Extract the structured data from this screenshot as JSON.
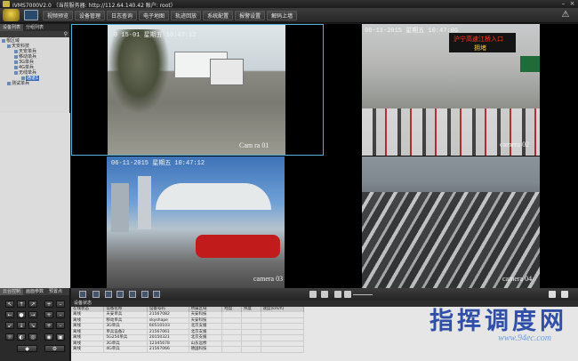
{
  "window": {
    "title": "IVMS7000V2.0 （当前服务器: http://112.64.140.42 账户: root）"
  },
  "toolbar": {
    "tabs": [
      "视频预览",
      "设备管理",
      "日志查询",
      "电子地图",
      "轨迹回放",
      "系统配置",
      "报警设置",
      "解码上墙"
    ]
  },
  "left_panel": {
    "tabs": [
      "设备列表",
      "分组列表"
    ],
    "tree": [
      {
        "label": "根区域",
        "level": 0
      },
      {
        "label": "天安科技",
        "level": 1
      },
      {
        "label": "天安单兵",
        "level": 2
      },
      {
        "label": "移动单兵",
        "level": 2
      },
      {
        "label": "3G单兵",
        "level": 2
      },
      {
        "label": "4G单兵",
        "level": 2
      },
      {
        "label": "无线单兵",
        "level": 2
      },
      {
        "label": "通道1",
        "level": 3,
        "selected": true
      },
      {
        "label": "测试单兵",
        "level": 1
      }
    ]
  },
  "video": {
    "cells": [
      {
        "osd": "0    15-01  星期五  10:47:12",
        "camera": "Cam  ra  01",
        "active": true
      },
      {
        "osd": "06-11-2015  星期五  10:47:06",
        "camera": "camera  02",
        "sign_line1": "沪宁高速江桥入口",
        "sign_line2": "拥堵"
      },
      {
        "osd": "06-11-2015    星期五    10:47:12",
        "camera": "camera  03"
      },
      {
        "osd": "",
        "camera": "camera  04"
      }
    ]
  },
  "ptz": {
    "tabs": [
      "云台控制",
      "画面参数",
      "预置点"
    ]
  },
  "device_table": {
    "title": "设备状态",
    "columns": [
      "在线状态",
      "设备名称",
      "设备号码",
      "所属区域",
      "经度",
      "纬度",
      "速度(km/h)"
    ],
    "rows": [
      [
        "离线",
        "天安单兵",
        "21567082",
        "天安科技",
        "",
        "",
        ""
      ],
      [
        "离线",
        "移动单兵",
        "skyshape",
        "天安科技",
        "",
        "",
        ""
      ],
      [
        "离线",
        "3G单兵",
        "60510103",
        "北京支援",
        "",
        "",
        ""
      ],
      [
        "离线",
        "单兵设备2",
        "21567061",
        "北京支援",
        "",
        "",
        ""
      ],
      [
        "离线",
        "5G250单兵",
        "20150321",
        "北京支援",
        "",
        "",
        ""
      ],
      [
        "离线",
        "3G单兵",
        "12345678",
        "山东远桥",
        "",
        "",
        ""
      ],
      [
        "离线",
        "4G单兵",
        "21567066",
        "德国科技",
        "",
        "",
        ""
      ]
    ]
  },
  "watermark": {
    "text": "指挥调度网",
    "url": "www.94ec.com"
  },
  "colors": {
    "active_border": "#4fb4d8",
    "selection": "#3a6fbf",
    "watermark": "#2f4fa8"
  }
}
